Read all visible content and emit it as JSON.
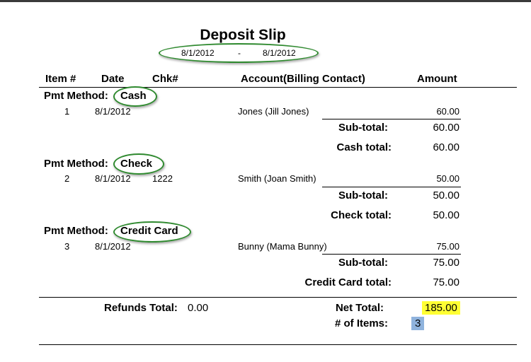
{
  "title": "Deposit Slip",
  "date_from": "8/1/2012",
  "date_separator": "-",
  "date_to": "8/1/2012",
  "columns": {
    "item": "Item #",
    "date": "Date",
    "chk": "Chk#",
    "account": "Account(Billing Contact)",
    "amount": "Amount"
  },
  "method_label": "Pmt Method:",
  "subtotal_label": "Sub-total:",
  "sections": [
    {
      "method": "Cash",
      "row": {
        "item": "1",
        "date": "8/1/2012",
        "chk": "",
        "account": "Jones (Jill Jones)",
        "amount": "60.00"
      },
      "subtotal": "60.00",
      "total_label": "Cash total:",
      "total": "60.00"
    },
    {
      "method": "Check",
      "row": {
        "item": "2",
        "date": "8/1/2012",
        "chk": "1222",
        "account": "Smith (Joan Smith)",
        "amount": "50.00"
      },
      "subtotal": "50.00",
      "total_label": "Check total:",
      "total": "50.00"
    },
    {
      "method": "Credit Card",
      "row": {
        "item": "3",
        "date": "8/1/2012",
        "chk": "",
        "account": "Bunny (Mama Bunny)",
        "amount": "75.00"
      },
      "subtotal": "75.00",
      "total_label": "Credit Card total:",
      "total": "75.00"
    }
  ],
  "refunds_label": "Refunds Total:",
  "refunds_value": "0.00",
  "net_total_label": "Net Total:",
  "net_total_value": "185.00",
  "items_label": "# of Items:",
  "items_value": "3",
  "colors": {
    "oval_green": "#2f8a2f",
    "net_highlight": "#ffff33",
    "items_highlight": "#8fb3dd"
  }
}
